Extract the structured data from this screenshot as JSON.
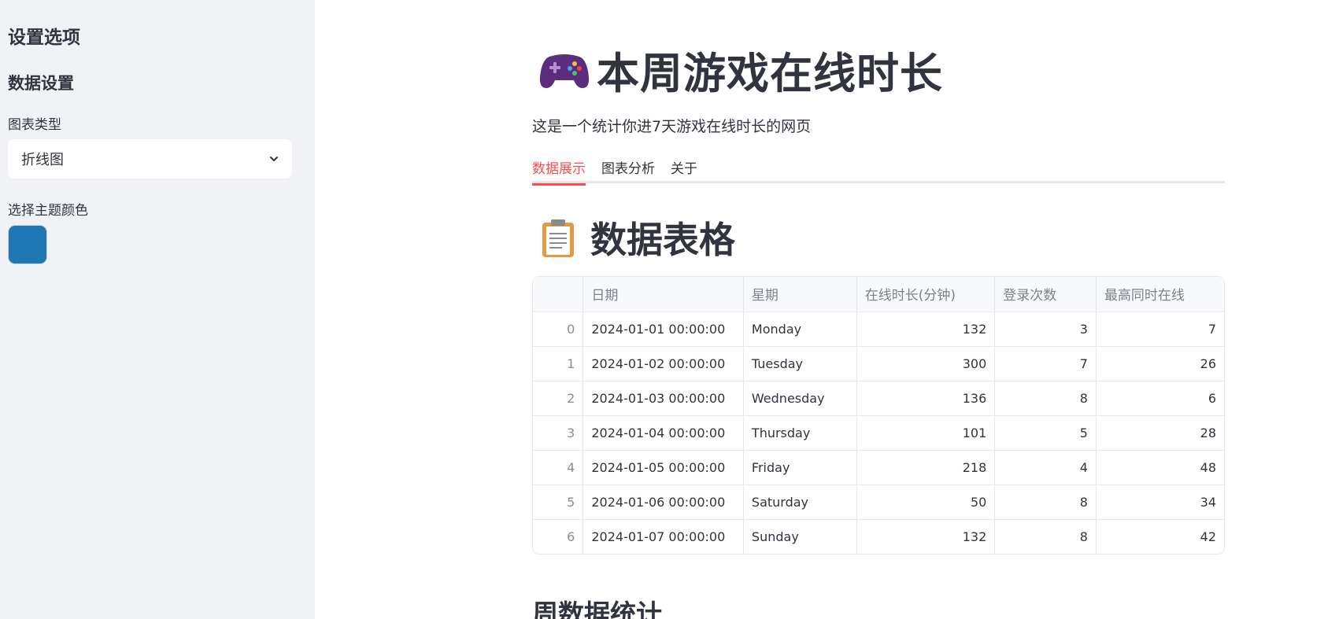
{
  "sidebar": {
    "heading": "设置选项",
    "section": "数据设置",
    "chart_type_label": "图表类型",
    "chart_type_value": "折线图",
    "theme_color_label": "选择主题颜色",
    "theme_color": "#1f77b4"
  },
  "main": {
    "title_icon": "game-controller-icon",
    "title": "本周游戏在线时长",
    "subtitle": "这是一个统计你进7天游戏在线时长的网页",
    "tabs": [
      {
        "label": "数据展示",
        "active": true
      },
      {
        "label": "图表分析",
        "active": false
      },
      {
        "label": "关于",
        "active": false
      }
    ],
    "section_icon": "clipboard-icon",
    "section_title": "数据表格",
    "table": {
      "columns": [
        "",
        "日期",
        "星期",
        "在线时长(分钟)",
        "登录次数",
        "最高同时在线"
      ],
      "rows": [
        [
          "0",
          "2024-01-01 00:00:00",
          "Monday",
          "132",
          "3",
          "7"
        ],
        [
          "1",
          "2024-01-02 00:00:00",
          "Tuesday",
          "300",
          "7",
          "26"
        ],
        [
          "2",
          "2024-01-03 00:00:00",
          "Wednesday",
          "136",
          "8",
          "6"
        ],
        [
          "3",
          "2024-01-04 00:00:00",
          "Thursday",
          "101",
          "5",
          "28"
        ],
        [
          "4",
          "2024-01-05 00:00:00",
          "Friday",
          "218",
          "4",
          "48"
        ],
        [
          "5",
          "2024-01-06 00:00:00",
          "Saturday",
          "50",
          "8",
          "34"
        ],
        [
          "6",
          "2024-01-07 00:00:00",
          "Sunday",
          "132",
          "8",
          "42"
        ]
      ]
    },
    "next_section_title": "周数据统计"
  },
  "colors": {
    "accent": "#ff4b4b",
    "sidebar_bg": "#f0f2f6",
    "text": "#31333f"
  }
}
